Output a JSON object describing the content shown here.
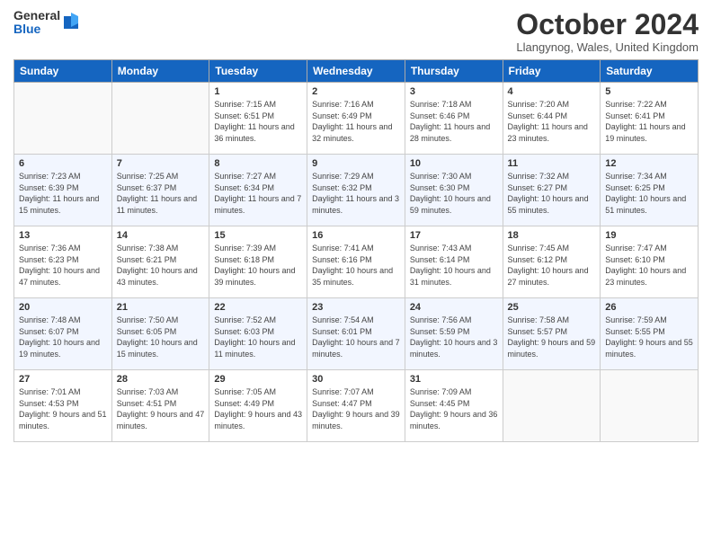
{
  "logo": {
    "general": "General",
    "blue": "Blue"
  },
  "title": "October 2024",
  "location": "Llangynog, Wales, United Kingdom",
  "days_of_week": [
    "Sunday",
    "Monday",
    "Tuesday",
    "Wednesday",
    "Thursday",
    "Friday",
    "Saturday"
  ],
  "weeks": [
    [
      {
        "day": "",
        "sunrise": "",
        "sunset": "",
        "daylight": ""
      },
      {
        "day": "",
        "sunrise": "",
        "sunset": "",
        "daylight": ""
      },
      {
        "day": "1",
        "sunrise": "Sunrise: 7:15 AM",
        "sunset": "Sunset: 6:51 PM",
        "daylight": "Daylight: 11 hours and 36 minutes."
      },
      {
        "day": "2",
        "sunrise": "Sunrise: 7:16 AM",
        "sunset": "Sunset: 6:49 PM",
        "daylight": "Daylight: 11 hours and 32 minutes."
      },
      {
        "day": "3",
        "sunrise": "Sunrise: 7:18 AM",
        "sunset": "Sunset: 6:46 PM",
        "daylight": "Daylight: 11 hours and 28 minutes."
      },
      {
        "day": "4",
        "sunrise": "Sunrise: 7:20 AM",
        "sunset": "Sunset: 6:44 PM",
        "daylight": "Daylight: 11 hours and 23 minutes."
      },
      {
        "day": "5",
        "sunrise": "Sunrise: 7:22 AM",
        "sunset": "Sunset: 6:41 PM",
        "daylight": "Daylight: 11 hours and 19 minutes."
      }
    ],
    [
      {
        "day": "6",
        "sunrise": "Sunrise: 7:23 AM",
        "sunset": "Sunset: 6:39 PM",
        "daylight": "Daylight: 11 hours and 15 minutes."
      },
      {
        "day": "7",
        "sunrise": "Sunrise: 7:25 AM",
        "sunset": "Sunset: 6:37 PM",
        "daylight": "Daylight: 11 hours and 11 minutes."
      },
      {
        "day": "8",
        "sunrise": "Sunrise: 7:27 AM",
        "sunset": "Sunset: 6:34 PM",
        "daylight": "Daylight: 11 hours and 7 minutes."
      },
      {
        "day": "9",
        "sunrise": "Sunrise: 7:29 AM",
        "sunset": "Sunset: 6:32 PM",
        "daylight": "Daylight: 11 hours and 3 minutes."
      },
      {
        "day": "10",
        "sunrise": "Sunrise: 7:30 AM",
        "sunset": "Sunset: 6:30 PM",
        "daylight": "Daylight: 10 hours and 59 minutes."
      },
      {
        "day": "11",
        "sunrise": "Sunrise: 7:32 AM",
        "sunset": "Sunset: 6:27 PM",
        "daylight": "Daylight: 10 hours and 55 minutes."
      },
      {
        "day": "12",
        "sunrise": "Sunrise: 7:34 AM",
        "sunset": "Sunset: 6:25 PM",
        "daylight": "Daylight: 10 hours and 51 minutes."
      }
    ],
    [
      {
        "day": "13",
        "sunrise": "Sunrise: 7:36 AM",
        "sunset": "Sunset: 6:23 PM",
        "daylight": "Daylight: 10 hours and 47 minutes."
      },
      {
        "day": "14",
        "sunrise": "Sunrise: 7:38 AM",
        "sunset": "Sunset: 6:21 PM",
        "daylight": "Daylight: 10 hours and 43 minutes."
      },
      {
        "day": "15",
        "sunrise": "Sunrise: 7:39 AM",
        "sunset": "Sunset: 6:18 PM",
        "daylight": "Daylight: 10 hours and 39 minutes."
      },
      {
        "day": "16",
        "sunrise": "Sunrise: 7:41 AM",
        "sunset": "Sunset: 6:16 PM",
        "daylight": "Daylight: 10 hours and 35 minutes."
      },
      {
        "day": "17",
        "sunrise": "Sunrise: 7:43 AM",
        "sunset": "Sunset: 6:14 PM",
        "daylight": "Daylight: 10 hours and 31 minutes."
      },
      {
        "day": "18",
        "sunrise": "Sunrise: 7:45 AM",
        "sunset": "Sunset: 6:12 PM",
        "daylight": "Daylight: 10 hours and 27 minutes."
      },
      {
        "day": "19",
        "sunrise": "Sunrise: 7:47 AM",
        "sunset": "Sunset: 6:10 PM",
        "daylight": "Daylight: 10 hours and 23 minutes."
      }
    ],
    [
      {
        "day": "20",
        "sunrise": "Sunrise: 7:48 AM",
        "sunset": "Sunset: 6:07 PM",
        "daylight": "Daylight: 10 hours and 19 minutes."
      },
      {
        "day": "21",
        "sunrise": "Sunrise: 7:50 AM",
        "sunset": "Sunset: 6:05 PM",
        "daylight": "Daylight: 10 hours and 15 minutes."
      },
      {
        "day": "22",
        "sunrise": "Sunrise: 7:52 AM",
        "sunset": "Sunset: 6:03 PM",
        "daylight": "Daylight: 10 hours and 11 minutes."
      },
      {
        "day": "23",
        "sunrise": "Sunrise: 7:54 AM",
        "sunset": "Sunset: 6:01 PM",
        "daylight": "Daylight: 10 hours and 7 minutes."
      },
      {
        "day": "24",
        "sunrise": "Sunrise: 7:56 AM",
        "sunset": "Sunset: 5:59 PM",
        "daylight": "Daylight: 10 hours and 3 minutes."
      },
      {
        "day": "25",
        "sunrise": "Sunrise: 7:58 AM",
        "sunset": "Sunset: 5:57 PM",
        "daylight": "Daylight: 9 hours and 59 minutes."
      },
      {
        "day": "26",
        "sunrise": "Sunrise: 7:59 AM",
        "sunset": "Sunset: 5:55 PM",
        "daylight": "Daylight: 9 hours and 55 minutes."
      }
    ],
    [
      {
        "day": "27",
        "sunrise": "Sunrise: 7:01 AM",
        "sunset": "Sunset: 4:53 PM",
        "daylight": "Daylight: 9 hours and 51 minutes."
      },
      {
        "day": "28",
        "sunrise": "Sunrise: 7:03 AM",
        "sunset": "Sunset: 4:51 PM",
        "daylight": "Daylight: 9 hours and 47 minutes."
      },
      {
        "day": "29",
        "sunrise": "Sunrise: 7:05 AM",
        "sunset": "Sunset: 4:49 PM",
        "daylight": "Daylight: 9 hours and 43 minutes."
      },
      {
        "day": "30",
        "sunrise": "Sunrise: 7:07 AM",
        "sunset": "Sunset: 4:47 PM",
        "daylight": "Daylight: 9 hours and 39 minutes."
      },
      {
        "day": "31",
        "sunrise": "Sunrise: 7:09 AM",
        "sunset": "Sunset: 4:45 PM",
        "daylight": "Daylight: 9 hours and 36 minutes."
      },
      {
        "day": "",
        "sunrise": "",
        "sunset": "",
        "daylight": ""
      },
      {
        "day": "",
        "sunrise": "",
        "sunset": "",
        "daylight": ""
      }
    ]
  ]
}
